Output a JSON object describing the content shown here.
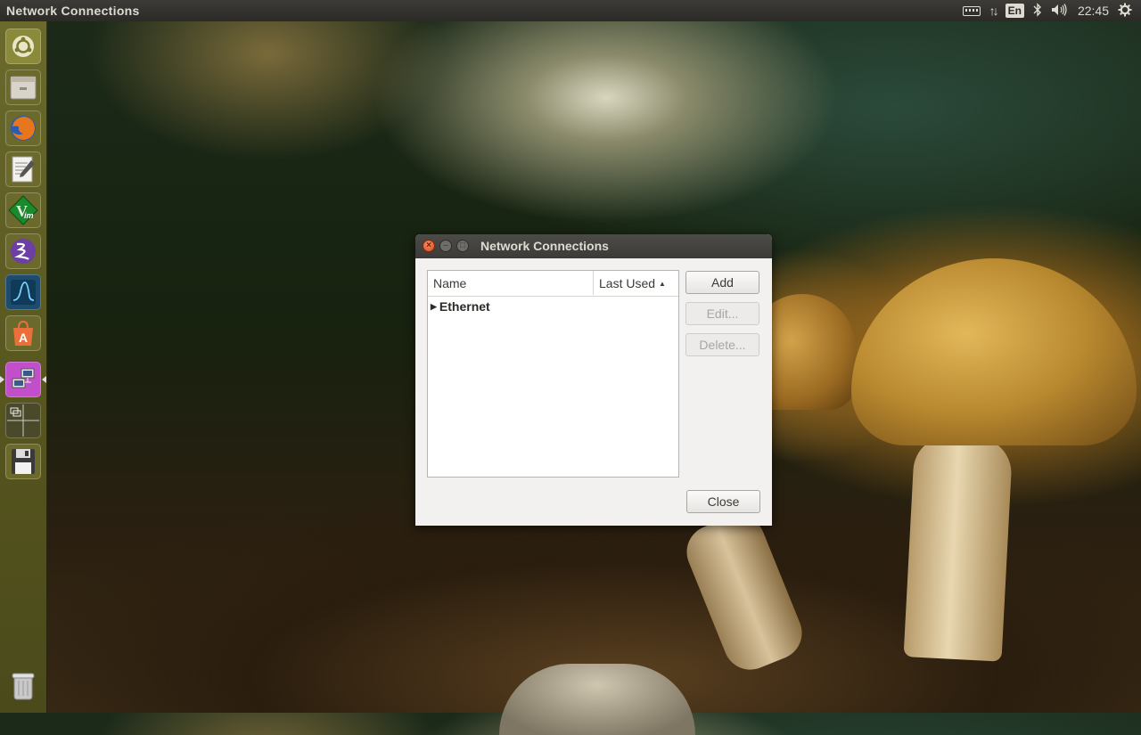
{
  "top_panel": {
    "app_title": "Network Connections",
    "language": "En",
    "clock": "22:45",
    "tray_icons": [
      "keyboard-icon",
      "network-arrows-icon",
      "language-indicator",
      "bluetooth-icon",
      "volume-icon",
      "clock",
      "gear-icon"
    ]
  },
  "launcher": {
    "items": [
      {
        "name": "ubuntu-dash-icon",
        "active": false
      },
      {
        "name": "files-icon",
        "active": false
      },
      {
        "name": "firefox-icon",
        "active": false
      },
      {
        "name": "text-editor-icon",
        "active": false
      },
      {
        "name": "vim-icon",
        "active": false
      },
      {
        "name": "emacs-icon",
        "active": false
      },
      {
        "name": "system-monitor-icon",
        "active": false
      },
      {
        "name": "software-center-icon",
        "active": false
      },
      {
        "name": "network-connections-icon",
        "active": true
      },
      {
        "name": "workspace-switcher-icon",
        "active": false
      },
      {
        "name": "save-disk-icon",
        "active": false
      },
      {
        "name": "trash-icon",
        "active": false
      }
    ]
  },
  "dialog": {
    "title": "Network Connections",
    "columns": {
      "name": "Name",
      "last_used": "Last Used"
    },
    "rows": [
      {
        "label": "Ethernet"
      }
    ],
    "buttons": {
      "add": "Add",
      "edit": "Edit...",
      "delete": "Delete...",
      "close": "Close"
    }
  },
  "colors": {
    "launcher_active": "#c04fc9",
    "close_button": "#e0491e",
    "panel": "#3c3b37"
  }
}
